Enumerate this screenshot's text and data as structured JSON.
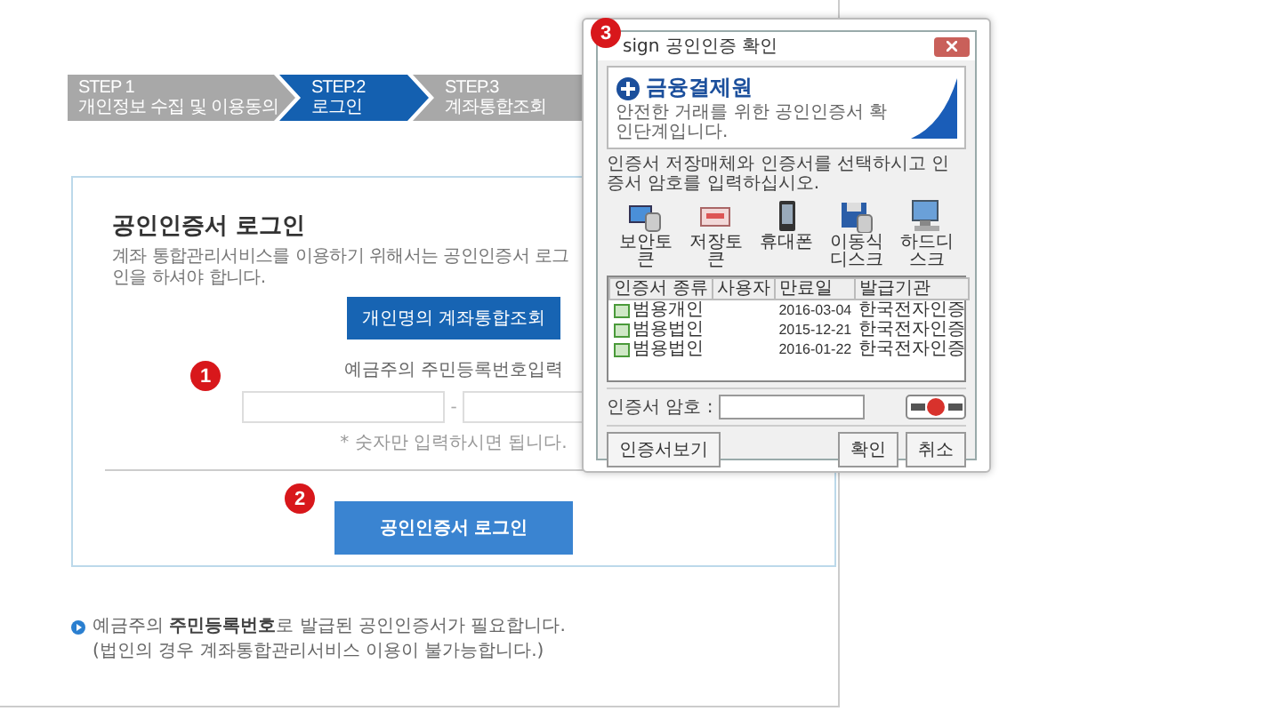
{
  "steps": [
    {
      "number": "STEP 1",
      "label": "개인정보 수집 및 이용동의",
      "selected": false
    },
    {
      "number": "STEP.2",
      "label": "로그인",
      "selected": true
    },
    {
      "number": "STEP.3",
      "label": "계좌통합조회",
      "selected": false
    }
  ],
  "login": {
    "title": "공인인증서 로그인",
    "description": "계좌 통합관리서비스를 이용하기 위해서는 공인인증서 로그인을 하셔야 합니다.",
    "personal_button": "개인명의 계좌통합조회",
    "id_label": "예금주의 주민등록번호입력",
    "id_separator": "-",
    "hint": "* 숫자만 입력하시면 됩니다.",
    "login_button": "공인인증서 로그인"
  },
  "notes": [
    "예금주의 **주민등록번호**로 발급된 공인인증서가 필요합니다.",
    "(법인의 경우 계좌통합관리서비스 이용이 불가능합니다.)"
  ],
  "markers": [
    "1",
    "2",
    "3"
  ],
  "dialog": {
    "title": "sign 공인인증 확인",
    "logo": "금융결제원",
    "tagline": "안전한 거래를 위한 공인인증서 확인단계입니다.",
    "instruction": "인증서 저장매체와 인증서를 선택하시고 인증서 암호를 입력하십시오.",
    "media": [
      {
        "kind": "token",
        "label": "보안토큰"
      },
      {
        "kind": "card",
        "label": "저장토큰"
      },
      {
        "kind": "phone",
        "label": "휴대폰"
      },
      {
        "kind": "floppy",
        "label": "이동식디스크"
      },
      {
        "kind": "computer",
        "label": "하드디스크"
      }
    ],
    "columns": [
      "인증서 종류",
      "사용자",
      "만료일",
      "발급기관"
    ],
    "rows": [
      {
        "type": "범용개인",
        "expiry": "2016-03-04",
        "issuer": "한국전자인증"
      },
      {
        "type": "범용법인",
        "expiry": "2015-12-21",
        "issuer": "한국전자인증"
      },
      {
        "type": "범용법인",
        "expiry": "2016-01-22",
        "issuer": "한국전자인증"
      }
    ],
    "password_label": "인증서 암호 :",
    "buttons": [
      "인증서보기",
      "확인",
      "취소"
    ]
  }
}
